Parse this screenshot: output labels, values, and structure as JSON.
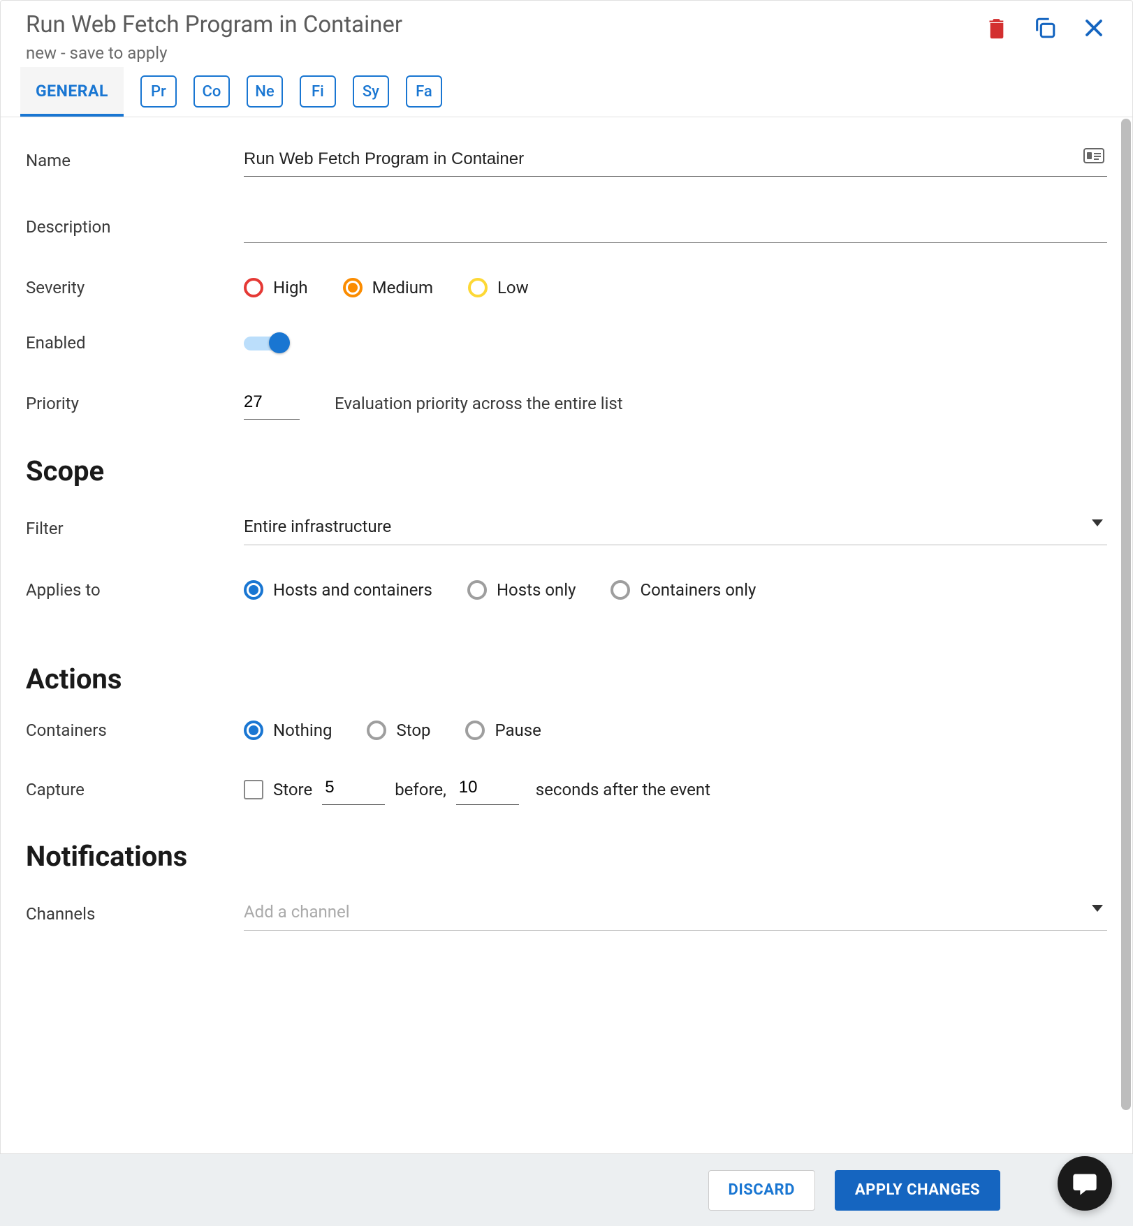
{
  "header": {
    "title": "Run Web Fetch Program in Container",
    "subtitle": "new - save to apply"
  },
  "tabs": {
    "active": "GENERAL",
    "pills": [
      "Pr",
      "Co",
      "Ne",
      "Fi",
      "Sy",
      "Fa"
    ]
  },
  "general": {
    "name_label": "Name",
    "name_value": "Run Web Fetch Program in Container",
    "description_label": "Description",
    "description_value": "",
    "severity_label": "Severity",
    "severity_options": {
      "high": "High",
      "medium": "Medium",
      "low": "Low"
    },
    "severity_selected": "Medium",
    "enabled_label": "Enabled",
    "enabled_value": true,
    "priority_label": "Priority",
    "priority_value": "27",
    "priority_hint": "Evaluation priority across the entire list"
  },
  "scope": {
    "heading": "Scope",
    "filter_label": "Filter",
    "filter_value": "Entire infrastructure",
    "applies_label": "Applies to",
    "applies_options": {
      "both": "Hosts and containers",
      "hosts": "Hosts only",
      "containers": "Containers only"
    },
    "applies_selected": "Hosts and containers"
  },
  "actions": {
    "heading": "Actions",
    "containers_label": "Containers",
    "containers_options": {
      "nothing": "Nothing",
      "stop": "Stop",
      "pause": "Pause"
    },
    "containers_selected": "Nothing",
    "capture_label": "Capture",
    "capture_store_label": "Store",
    "capture_before_value": "5",
    "capture_mid_text": "before,",
    "capture_after_value": "10",
    "capture_tail_text": "seconds after the event"
  },
  "notifications": {
    "heading": "Notifications",
    "channels_label": "Channels",
    "channels_placeholder": "Add a channel"
  },
  "footer": {
    "discard": "DISCARD",
    "apply": "APPLY CHANGES"
  }
}
